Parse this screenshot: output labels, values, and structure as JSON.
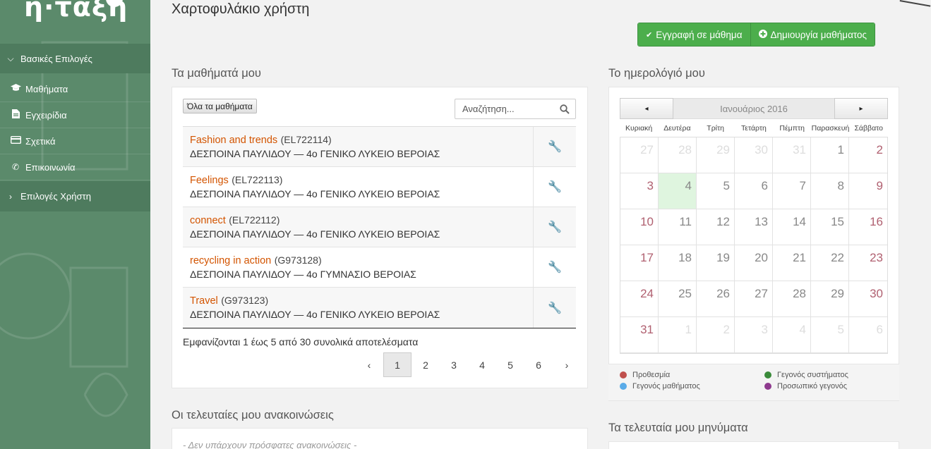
{
  "app": {
    "logo_text": "η·τάξη"
  },
  "sidebar": {
    "sections": [
      {
        "label": "Βασικές Επιλογές",
        "expanded": true
      },
      {
        "label": "Επιλογές Χρήστη",
        "expanded": false
      }
    ],
    "items": [
      {
        "label": "Μαθήματα",
        "icon": "graduation-cap-icon"
      },
      {
        "label": "Εγχειρίδια",
        "icon": "document-icon"
      },
      {
        "label": "Σχετικά",
        "icon": "credit-card-icon"
      },
      {
        "label": "Επικοινωνία",
        "icon": "phone-icon"
      }
    ]
  },
  "header": {
    "title": "Χαρτοφυλάκιο χρήστη",
    "enroll_button": "Εγγραφή σε μάθημα",
    "create_button": "Δημιουργία μαθήματος"
  },
  "courses": {
    "section_title": "Τα μαθήματά μου",
    "all_button": "Όλα τα μαθήματα",
    "search_placeholder": "Αναζήτηση...",
    "rows": [
      {
        "title": "Fashion and trends",
        "code": "(EL722114)",
        "teacher": "ΔΕΣΠΟΙΝΑ ΠΑΥΛΙΔΟΥ — 4ο ΓΕΝΙΚΟ ΛΥΚΕΙΟ ΒΕΡΟΙΑΣ"
      },
      {
        "title": "Feelings",
        "code": "(EL722113)",
        "teacher": "ΔΕΣΠΟΙΝΑ ΠΑΥΛΙΔΟΥ — 4ο ΓΕΝΙΚΟ ΛΥΚΕΙΟ ΒΕΡΟΙΑΣ"
      },
      {
        "title": "connect",
        "code": "(EL722112)",
        "teacher": "ΔΕΣΠΟΙΝΑ ΠΑΥΛΙΔΟΥ — 4ο ΓΕΝΙΚΟ ΛΥΚΕΙΟ ΒΕΡΟΙΑΣ"
      },
      {
        "title": "recycling in action",
        "code": "(G973128)",
        "teacher": "ΔΕΣΠΟΙΝΑ ΠΑΥΛΙΔΟΥ — 4ο ΓΥΜΝΑΣΙΟ ΒΕΡΟΙΑΣ"
      },
      {
        "title": "Travel",
        "code": "(G973123)",
        "teacher": "ΔΕΣΠΟΙΝΑ ΠΑΥΛΙΔΟΥ — 4ο ΓΕΝΙΚΟ ΛΥΚΕΙΟ ΒΕΡΟΙΑΣ"
      }
    ],
    "results_text": "Εμφανίζονται 1 έως 5 από 30 συνολικά αποτελέσματα",
    "pager": {
      "prev": "‹",
      "pages": [
        "1",
        "2",
        "3",
        "4",
        "5",
        "6"
      ],
      "active": "1",
      "next": "›"
    }
  },
  "calendar": {
    "section_title": "Το ημερολόγιό μου",
    "month_label": "Ιανουάριος 2016",
    "prev": "◂",
    "next": "▸",
    "weekdays": [
      "Κυριακή",
      "Δευτέρα",
      "Τρίτη",
      "Τετάρτη",
      "Πέμπτη",
      "Παρασκευή",
      "Σάββατο"
    ],
    "days": [
      {
        "d": "27",
        "other": true
      },
      {
        "d": "28",
        "other": true
      },
      {
        "d": "29",
        "other": true
      },
      {
        "d": "30",
        "other": true
      },
      {
        "d": "31",
        "other": true
      },
      {
        "d": "1"
      },
      {
        "d": "2"
      },
      {
        "d": "3"
      },
      {
        "d": "4",
        "today": true
      },
      {
        "d": "5"
      },
      {
        "d": "6"
      },
      {
        "d": "7"
      },
      {
        "d": "8"
      },
      {
        "d": "9"
      },
      {
        "d": "10"
      },
      {
        "d": "11"
      },
      {
        "d": "12"
      },
      {
        "d": "13"
      },
      {
        "d": "14"
      },
      {
        "d": "15"
      },
      {
        "d": "16"
      },
      {
        "d": "17"
      },
      {
        "d": "18"
      },
      {
        "d": "19"
      },
      {
        "d": "20"
      },
      {
        "d": "21"
      },
      {
        "d": "22"
      },
      {
        "d": "23"
      },
      {
        "d": "24"
      },
      {
        "d": "25"
      },
      {
        "d": "26"
      },
      {
        "d": "27"
      },
      {
        "d": "28"
      },
      {
        "d": "29"
      },
      {
        "d": "30"
      },
      {
        "d": "31"
      },
      {
        "d": "1",
        "other": true
      },
      {
        "d": "2",
        "other": true
      },
      {
        "d": "3",
        "other": true
      },
      {
        "d": "4",
        "other": true
      },
      {
        "d": "5",
        "other": true
      },
      {
        "d": "6",
        "other": true
      }
    ],
    "legend": [
      {
        "label": "Προθεσμία",
        "color": "#c0504d"
      },
      {
        "label": "Γεγονός συστήματος",
        "color": "#3a8a3a"
      },
      {
        "label": "Γεγονός μαθήματος",
        "color": "#5aabe8"
      },
      {
        "label": "Προσωπικό γεγονός",
        "color": "#8e3a8e"
      }
    ]
  },
  "announcements": {
    "section_title": "Οι τελευταίες μου ανακοινώσεις",
    "empty_text": "- Δεν υπάρχουν πρόσφατες ανακοινώσεις -"
  },
  "messages": {
    "section_title": "Τα τελευταία μου μηνύματα"
  }
}
